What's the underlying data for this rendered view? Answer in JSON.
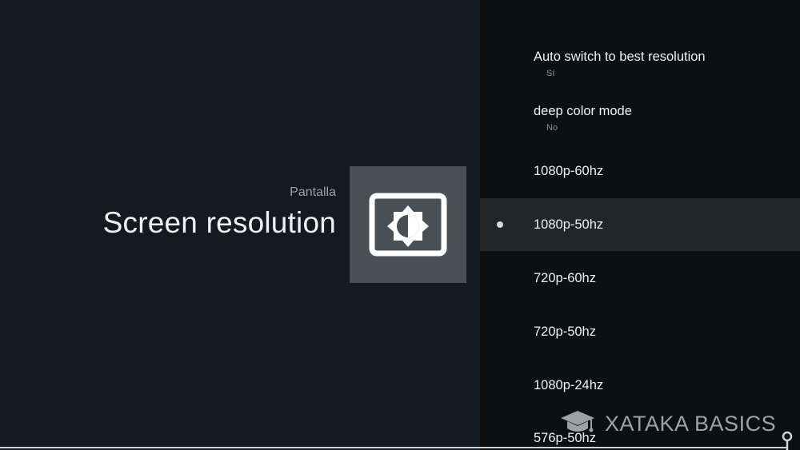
{
  "header": {
    "breadcrumb": "Pantalla",
    "title": "Screen resolution",
    "icon": "brightness-display-icon"
  },
  "list": {
    "items": [
      {
        "title": "Auto switch to best resolution",
        "subtitle": "Sí"
      },
      {
        "title": "deep color mode",
        "subtitle": "No"
      },
      {
        "title": "1080p-60hz"
      },
      {
        "title": "1080p-50hz",
        "selected": true
      },
      {
        "title": "720p-60hz"
      },
      {
        "title": "720p-50hz"
      },
      {
        "title": "1080p-24hz"
      },
      {
        "title": "576p-50hz"
      }
    ]
  },
  "watermark": {
    "text": "XATAKA BASICS",
    "icon": "graduation-cap-icon"
  },
  "colors": {
    "background": "#141b20",
    "panel": "#0e0f10",
    "selected_row": "#232526",
    "icon_tile": "#4a4f53"
  }
}
